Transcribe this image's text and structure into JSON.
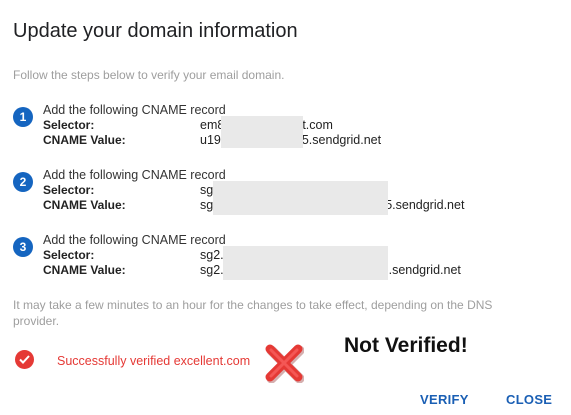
{
  "dialog": {
    "title": "Update your domain information",
    "intro": "Follow the steps below to verify your email domain."
  },
  "steps": [
    {
      "number": "1",
      "heading": "Add the following CNAME record",
      "selector_label": "Selector:",
      "cname_label": "CNAME Value:",
      "selector_prefix": "em8",
      "selector_suffix": "t.com",
      "cname_prefix": "u19",
      "cname_suffix": "5.sendgrid.net"
    },
    {
      "number": "2",
      "heading": "Add the following CNAME record",
      "selector_label": "Selector:",
      "cname_label": "CNAME Value:",
      "selector_prefix": "sg",
      "selector_suffix": "",
      "cname_prefix": "sg",
      "cname_suffix": "5.sendgrid.net"
    },
    {
      "number": "3",
      "heading": "Add the following CNAME record",
      "selector_label": "Selector:",
      "cname_label": "CNAME Value:",
      "selector_prefix": "sg2.",
      "selector_suffix": "",
      "cname_prefix": "sg2.",
      "cname_suffix": "5.sendgrid.net"
    }
  ],
  "note": "It may take a few minutes to an hour for the changes to take effect, depending on the DNS provider.",
  "status": {
    "icon": "check-circle-icon",
    "text": "Successfully verified excellent.com",
    "color": "#e53935"
  },
  "overlay": {
    "cross_icon": "red-x-icon",
    "annotation": "Not Verified!"
  },
  "actions": {
    "verify_label": "VERIFY",
    "close_label": "CLOSE",
    "accent": "#1a5fb4"
  }
}
